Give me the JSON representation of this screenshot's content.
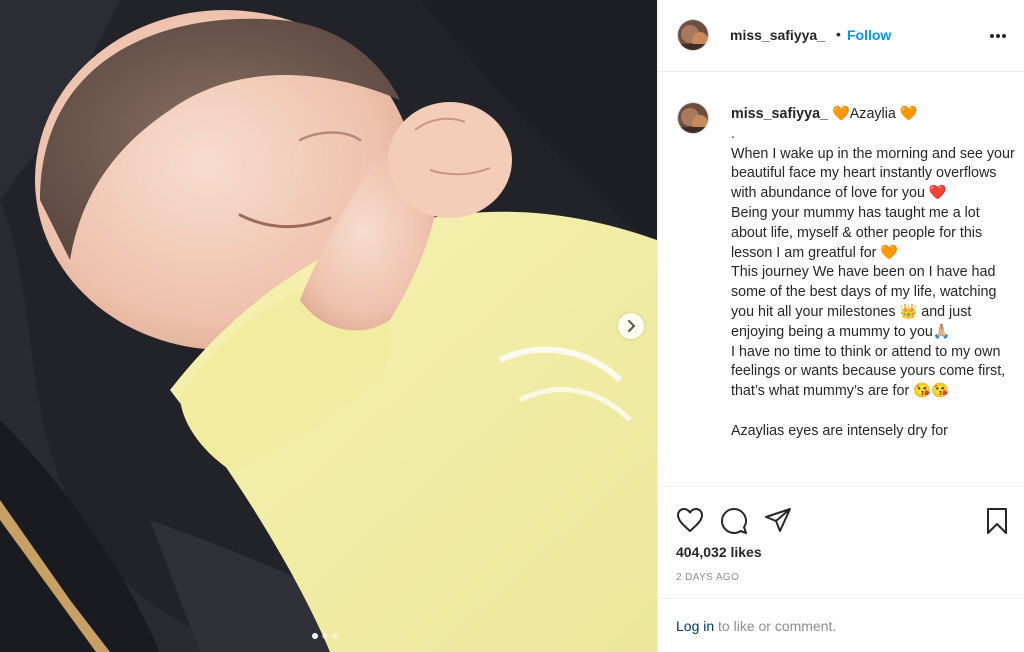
{
  "post": {
    "username": "miss_safiyya_",
    "follow_separator": "•",
    "follow_label": "Follow",
    "more_icon": "more-options-icon",
    "carousel": {
      "slide_count": 3,
      "active_slide": 1
    }
  },
  "caption": {
    "username": "miss_safiyya_",
    "text": "🧡Azaylia 🧡\n.\nWhen I wake up in the morning and see your beautiful face my heart instantly overflows with abundance of love for you ❤️\nBeing your mummy has taught me a lot about life, myself & other people for this lesson I am greatful for 🧡\nThis journey We have been on I have had some of the best days of my life, watching you hit all your milestones 👑 and just enjoying being a mummy to you🙏🏼\nI have no time to think or attend to my own feelings or wants because yours come first, that’s what mummy’s are for 😘😘\n\nAzaylias eyes are intensely dry for"
  },
  "actions": {
    "like_icon": "heart-icon",
    "comment_icon": "comment-icon",
    "share_icon": "share-icon",
    "save_icon": "bookmark-icon",
    "likes": "404,032 likes",
    "date": "2 DAYS AGO",
    "login_link": "Log in",
    "login_suffix": " to like or comment."
  },
  "colors": {
    "follow": "#0095f6",
    "link": "#00376b",
    "muted": "#8e8e8e",
    "border": "#efefef"
  }
}
